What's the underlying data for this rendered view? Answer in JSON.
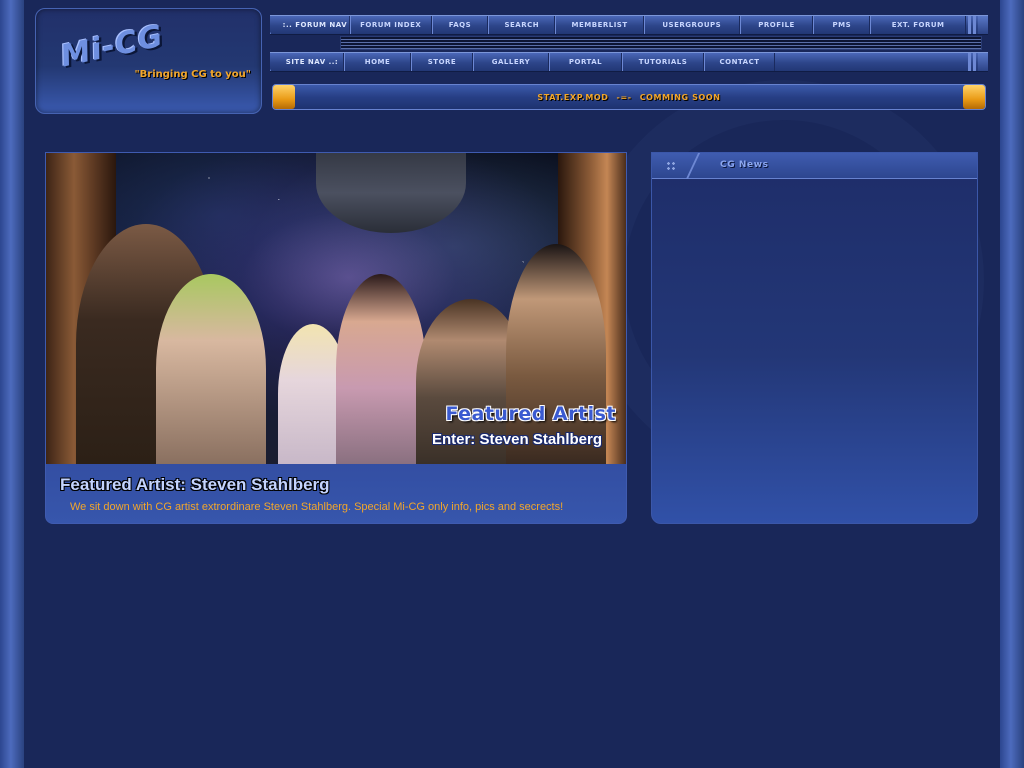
{
  "logo": {
    "name": "Mi-CG",
    "slogan": "\"Bringing CG to you\""
  },
  "forum_nav": {
    "label": ":.. FORUM NAV",
    "items": [
      "FORUM INDEX",
      "FAQS",
      "SEARCH",
      "MEMBERLIST",
      "USERGROUPS",
      "PROFILE",
      "PMS",
      "EXT. FORUM"
    ]
  },
  "site_nav": {
    "label": "SITE NAV ..:",
    "items": [
      "HOME",
      "STORE",
      "GALLERY",
      "PORTAL",
      "TUTORIALS",
      "CONTACT"
    ]
  },
  "stat_bar": {
    "left": "STAT.EXP.MOD",
    "sep": "-=-",
    "right": "COMMING SOON"
  },
  "featured": {
    "hero_title": "Featured Artist",
    "hero_sub": "Enter: Steven Stahlberg",
    "title": "Featured Artist: Steven Stahlberg",
    "desc": "We sit down with CG artist extrordinare Steven Stahlberg.  Special Mi-CG only info, pics and secrects!"
  },
  "news": {
    "title": "CG News"
  },
  "colors": {
    "accent": "#f2a62b",
    "bg": "#192759",
    "link": "#c8d6ff"
  }
}
